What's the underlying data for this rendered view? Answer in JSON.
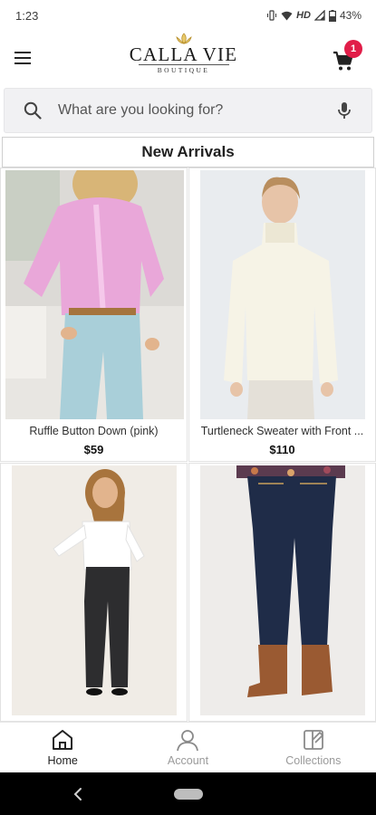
{
  "status_bar": {
    "time": "1:23",
    "network": "HD",
    "battery": "43%"
  },
  "header": {
    "logo_name": "CALLA VIE",
    "logo_sub": "BOUTIQUE",
    "cart_count": "1"
  },
  "search": {
    "placeholder": "What are you looking for?"
  },
  "section": {
    "title": "New Arrivals"
  },
  "products": [
    {
      "name": "Ruffle Button Down (pink)",
      "price": "$59"
    },
    {
      "name": "Turtleneck Sweater with Front ...",
      "price": "$110"
    },
    {
      "name": "",
      "price": ""
    },
    {
      "name": "",
      "price": ""
    }
  ],
  "bottom_nav": {
    "home": "Home",
    "account": "Account",
    "collections": "Collections"
  },
  "colors": {
    "accent": "#e11d48",
    "search_bg": "#f1f1f3",
    "inactive": "#9a9a9a"
  }
}
